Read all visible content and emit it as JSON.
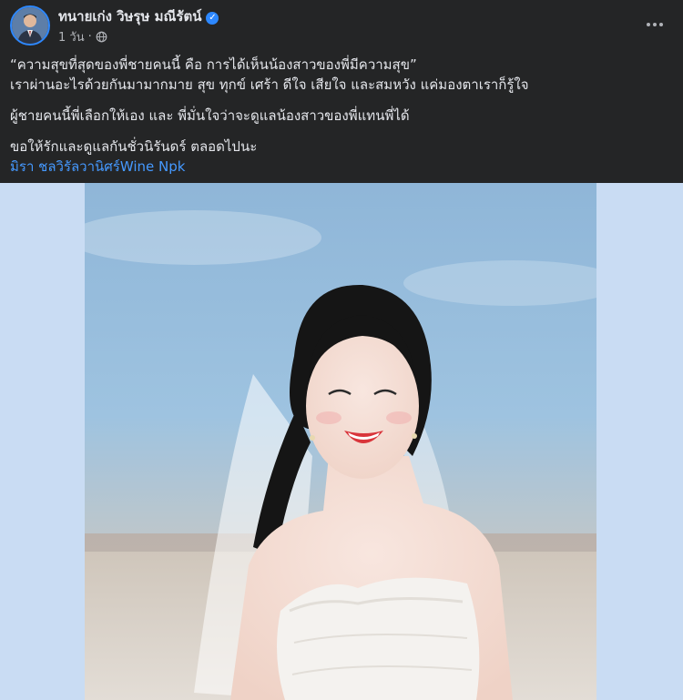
{
  "post": {
    "author": "ทนายเก่ง วิษรุษ มณีรัตน์",
    "time": "1 วัน",
    "separator": "·",
    "text_lines": [
      "“ความสุขที่สุดของพี่ชายคนนี้ คือ การได้เห็นน้องสาวของพี่มีความสุข”",
      "เราผ่านอะไรด้วยกันมามากมาย สุข ทุกข์ เศร้า ดีใจ เสียใจ และสมหวัง แค่มองตาเราก็รู้ใจ",
      "ผู้ชายคนนี้พี่เลือกให้เอง และ พี่มั่นใจว่าจะดูแลน้องสาวของพี่แทนพี่ได้",
      "ขอให้รักและดูแลกันชั่วนิรันดร์ ตลอดไปนะ"
    ],
    "tagged": "มิรา ชลวิรัลวานิศร์Wine Npk"
  },
  "icons": {
    "verified": "verified-badge-icon",
    "privacy": "globe-icon",
    "more": "more-options-icon"
  },
  "colors": {
    "background": "#242526",
    "text": "#e4e6eb",
    "secondary": "#b0b3b8",
    "link": "#4599ff",
    "verified": "#2d88ff",
    "photo_backdrop": "#c9dcf3"
  }
}
